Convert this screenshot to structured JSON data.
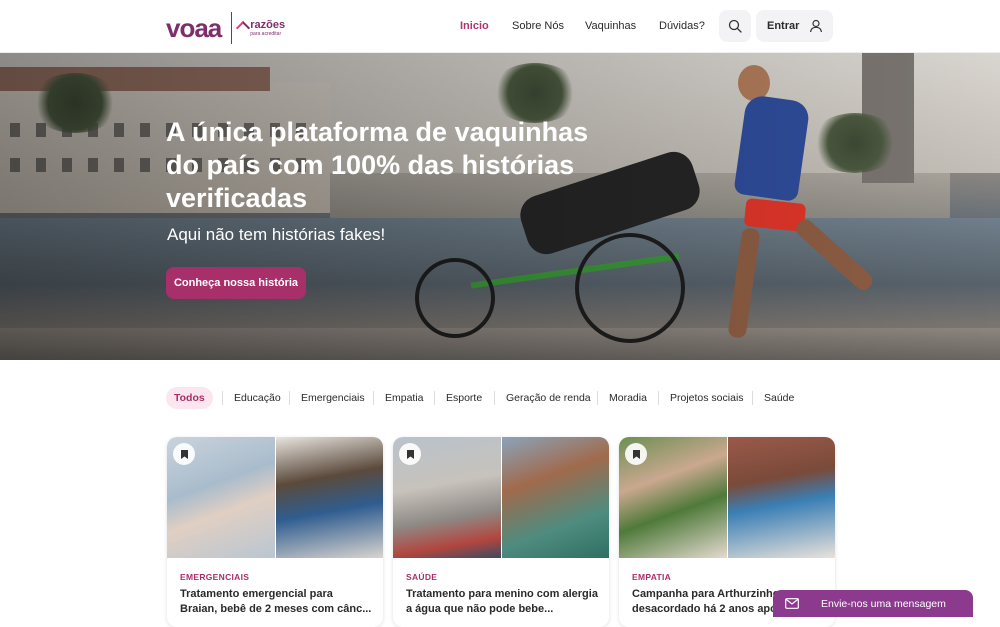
{
  "brand": {
    "logo_text": "voaa",
    "partner_line1": "razões",
    "partner_line2": "para acreditar"
  },
  "nav": {
    "items": [
      "Inicio",
      "Sobre Nós",
      "Vaquinhas",
      "Dúvidas?"
    ],
    "active": "Inicio",
    "login_label": "Entrar"
  },
  "hero": {
    "title": "A única plataforma de vaquinhas do país com 100% das histórias verificadas",
    "subtitle": "Aqui não tem histórias fakes!",
    "cta_label": "Conheça nossa história"
  },
  "filters": {
    "items": [
      "Todos",
      "Educação",
      "Emergenciais",
      "Empatia",
      "Esporte",
      "Geração de renda",
      "Moradia",
      "Projetos sociais",
      "Saúde"
    ],
    "active": "Todos"
  },
  "cards": [
    {
      "category": "EMERGENCIAIS",
      "title": "Tratamento emergencial para Braian, bebê de 2 meses com cânc..."
    },
    {
      "category": "SAÚDE",
      "title": "Tratamento para menino com alergia a água que não pode bebe..."
    },
    {
      "category": "EMPATIA",
      "title": "Campanha para Arthurzinho desacordado há 2 anos apó..."
    }
  ],
  "message_bar": {
    "label": "Envie-nos uma mensagem"
  },
  "colors": {
    "brand": "#7d2e6b",
    "accent": "#a8306a",
    "chip_bg": "#fbe6ef",
    "message_bar": "#8b3a8e"
  },
  "icons": {
    "search": "search-icon",
    "user": "user-icon",
    "bookmark": "bookmark-icon",
    "mail": "mail-icon"
  }
}
